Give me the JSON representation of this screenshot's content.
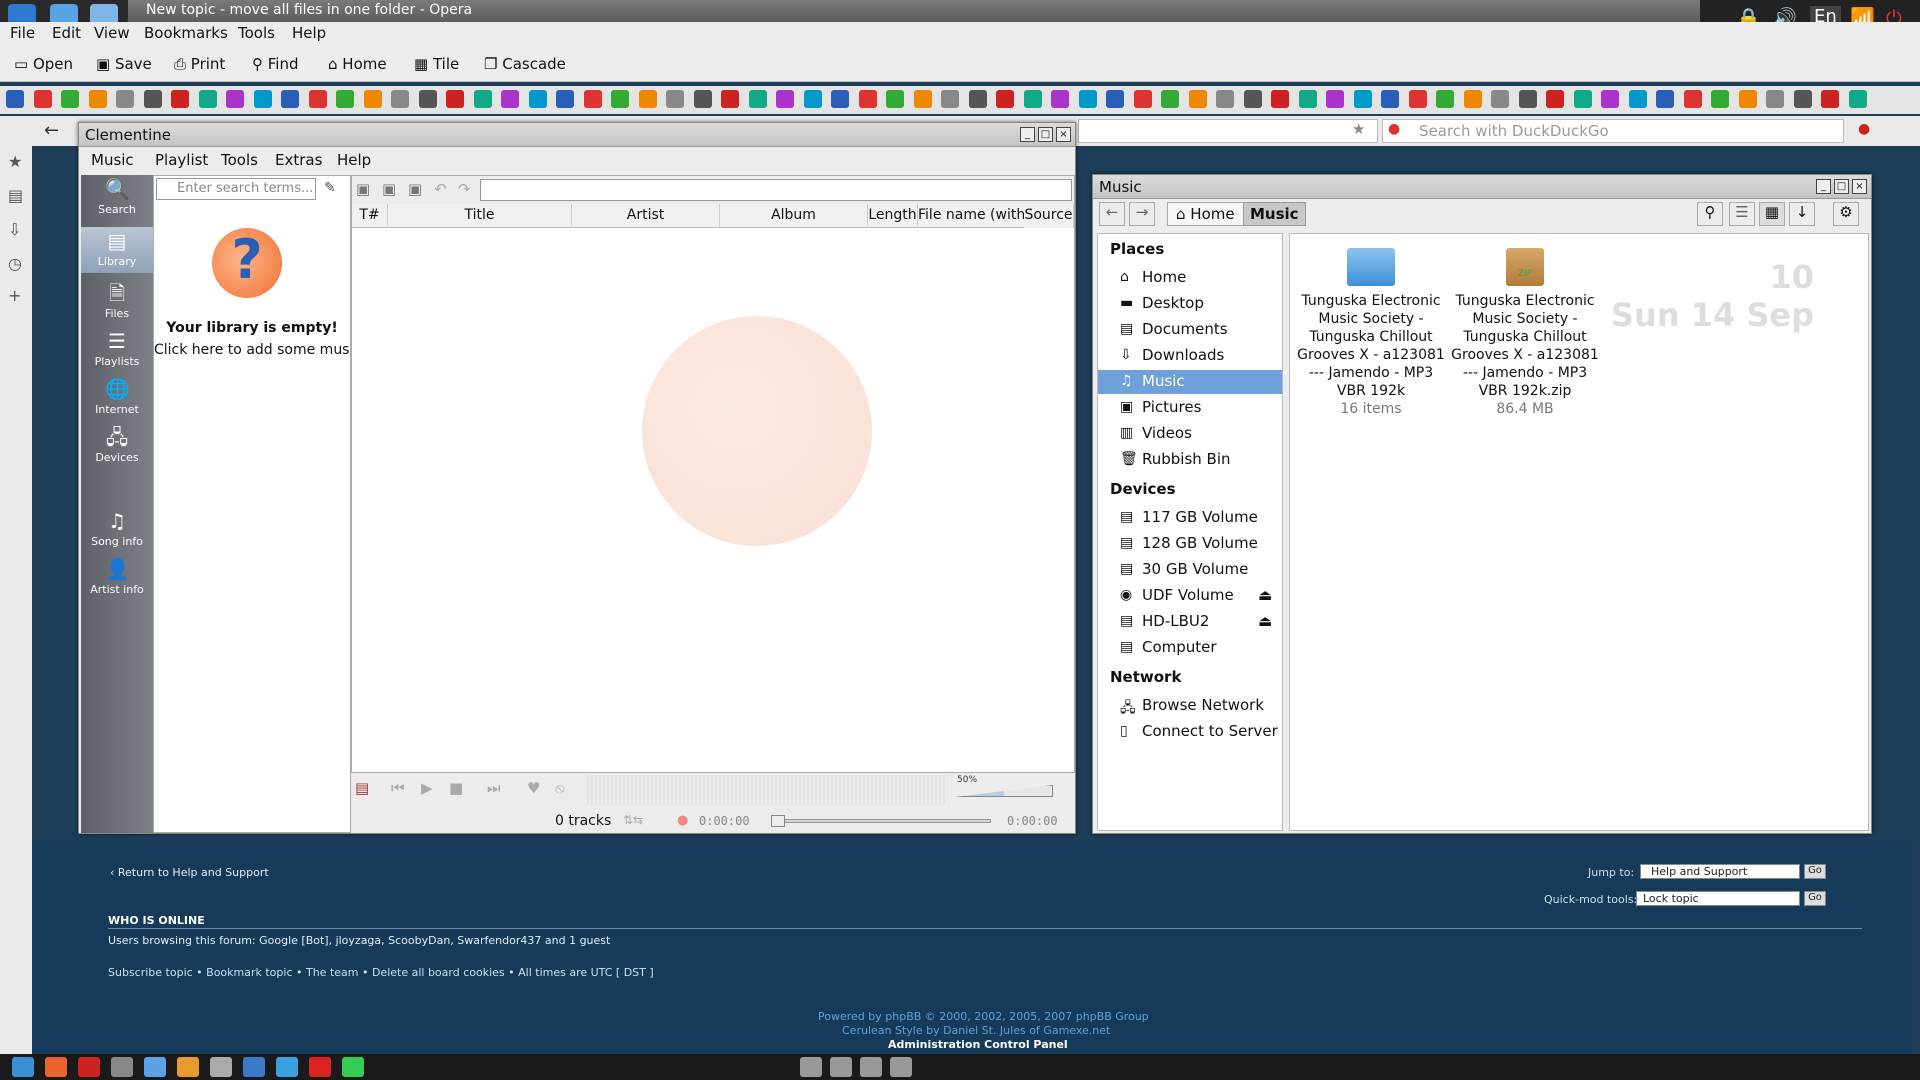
{
  "opera": {
    "title": "New topic - move all files in one folder - Opera",
    "menu": [
      "File",
      "Edit",
      "View",
      "Bookmarks",
      "Tools",
      "Help"
    ],
    "toolbar": [
      "Open",
      "Save",
      "Print",
      "Find",
      "Home",
      "Tile",
      "Cascade"
    ],
    "search_placeholder": "Search with DuckDuckGo",
    "lang": "En"
  },
  "clementine": {
    "title": "Clementine",
    "menu": [
      "Music",
      "Playlist",
      "Tools",
      "Extras",
      "Help"
    ],
    "sidebar": [
      "Search",
      "Library",
      "Files",
      "Playlists",
      "Internet",
      "Devices",
      "Song info",
      "Artist info"
    ],
    "search_placeholder": "Enter search terms...",
    "empty_title": "Your library is empty!",
    "empty_sub": "Click here to add some music",
    "columns": [
      "T#",
      "Title",
      "Artist",
      "Album",
      "Length",
      "File name (without path)",
      "Source"
    ],
    "tracks": "0 tracks",
    "time_left": "0:00:00",
    "time_right": "0:00:00",
    "volume": "50%"
  },
  "music": {
    "title": "Music",
    "path": [
      "Home",
      "Music"
    ],
    "places_head": "Places",
    "places": [
      "Home",
      "Desktop",
      "Documents",
      "Downloads",
      "Music",
      "Pictures",
      "Videos",
      "Rubbish Bin"
    ],
    "devices_head": "Devices",
    "devices": [
      "117 GB Volume",
      "128 GB Volume",
      "30 GB Volume",
      "UDF Volume",
      "HD-LBU2",
      "Computer"
    ],
    "network_head": "Network",
    "network": [
      "Browse Network",
      "Connect to Server"
    ],
    "files": [
      {
        "name": "Tunguska Electronic Music Society - Tunguska Chillout Grooves X - a123081 --- Jamendo - MP3 VBR 192k",
        "info": "16 items"
      },
      {
        "name": "Tunguska Electronic Music Society - Tunguska Chillout Grooves X - a123081 --- Jamendo - MP3 VBR 192k.zip",
        "info": "86.4 MB"
      }
    ],
    "clock_time": "10",
    "clock_date": "Sun 14 Sep"
  },
  "forum": {
    "return": "‹ Return to Help and Support",
    "jump_label": "Jump to:",
    "jump_value": "Help and Support",
    "go": "Go",
    "quickmod_label": "Quick-mod tools:",
    "quickmod_value": "Lock topic",
    "who_head": "WHO IS ONLINE",
    "who_text": "Users browsing this forum: Google [Bot], jloyzaga, ScoobyDan, Swarfendor437 and 1 guest",
    "links": "Subscribe topic • Bookmark topic • The team • Delete all board cookies • All times are UTC [ DST ]",
    "powered": "Powered by phpBB © 2000, 2002, 2005, 2007 phpBB Group",
    "style": "Cerulean Style by Daniel St. Jules of Gamexe.net",
    "acp": "Administration Control Panel"
  }
}
